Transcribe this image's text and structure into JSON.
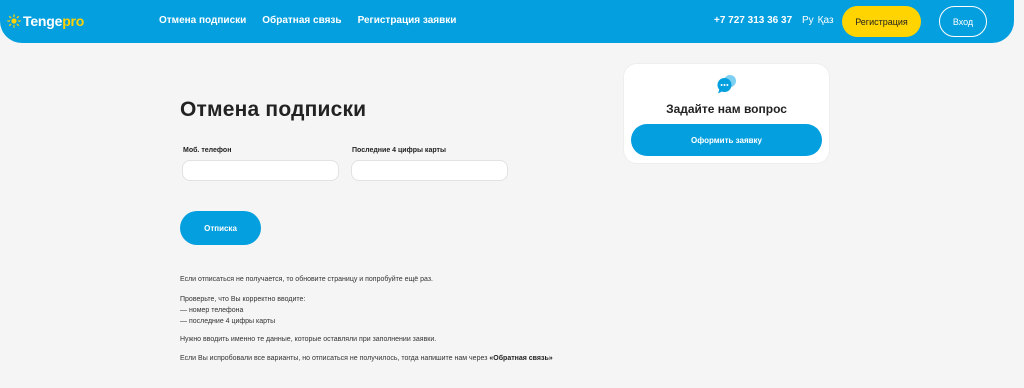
{
  "header": {
    "logo": {
      "part1": "Tenge",
      "part2": "pro"
    },
    "nav": [
      "Отмена подписки",
      "Обратная связь",
      "Регистрация заявки"
    ],
    "phone": "+7 727 313 36 37",
    "languages": [
      "Ру",
      "Қаз"
    ],
    "register_label": "Регистрация",
    "login_label": "Вход"
  },
  "colors": {
    "brand_blue": "#049fde",
    "brand_yellow": "#ffd400",
    "background": "#f5f5f5"
  },
  "form": {
    "title": "Отмена подписки",
    "phone_label": "Моб. телефон",
    "phone_value": "",
    "card_label": "Последние 4 цифры карты",
    "card_value": "",
    "submit_label": "Отписка"
  },
  "info": {
    "p1": "Если отписаться не получается, то обновите страницу и попробуйте ещё раз.",
    "p2_intro": "Проверьте, что Вы корректно вводите:",
    "p2_item1": "— номер телефона",
    "p2_item2": "— последние 4 цифры карты",
    "p3": "Нужно вводить именно те данные, которые оставляли при заполнении заявки.",
    "p4_text": "Если Вы испробовали все варианты, но отписаться не получилось, тогда напишите нам через",
    "p4_link": "«Обратная связь»"
  },
  "question_card": {
    "icon": "chat-bubbles-icon",
    "title": "Задайте нам вопрос",
    "button_label": "Оформить заявку"
  }
}
